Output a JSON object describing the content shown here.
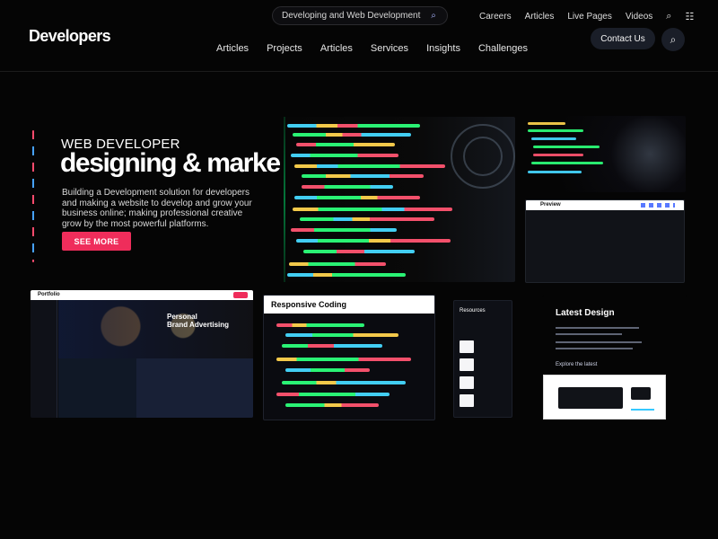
{
  "app": {
    "brand": "Developers"
  },
  "header": {
    "search_value": "Developing and Web Development",
    "utility_nav": [
      "Careers",
      "Articles",
      "Live Pages",
      "Videos"
    ],
    "main_nav": [
      "Articles",
      "Projects",
      "Articles",
      "Services",
      "Insights",
      "Challenges"
    ],
    "cta_label": "Contact Us",
    "icons": {
      "search": "search-icon",
      "menu": "grid-icon",
      "dropdown": "chevron-down-icon"
    }
  },
  "hero": {
    "eyebrow": "WEB DEVELOPER",
    "title": "designing & marketing",
    "description_lines": [
      "Building a Development solution for developers",
      "and making a website to develop and grow your",
      "business online; making professional creative",
      "grow by the most powerful platforms."
    ],
    "cta_label": "SEE MORE"
  },
  "showcase": {
    "panel_titles": {
      "top_right_mid": "Preview",
      "gallery_one_brand": "Portfolio",
      "gallery_one_title_line_1": "Personal",
      "gallery_one_title_line_2": "Brand Advertising",
      "gallery_two_title": "Responsive Coding",
      "gallery_four_title": "Latest Design",
      "gallery_four_caption": "Explore the latest",
      "gallery_three_label": "Resources"
    }
  },
  "colors": {
    "accent_pink": "#ef2d5b",
    "accent_blue": "#46a2ff",
    "background": "#050505",
    "code_green": "#2cff7a",
    "code_yellow": "#ffd34d",
    "code_red": "#ff5470",
    "code_cyan": "#45d8ff"
  }
}
